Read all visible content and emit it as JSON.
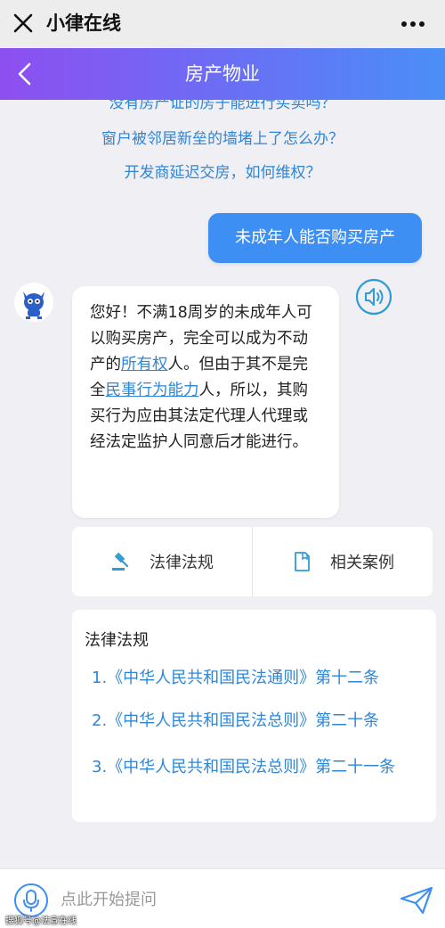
{
  "topbar": {
    "app_title": "小律在线"
  },
  "header": {
    "title": "房产物业"
  },
  "suggestions": [
    "没有房产证的房子能进行买卖吗？",
    "窗户被邻居新垒的墙堵上了怎么办？",
    "开发商延迟交房，如何维权？"
  ],
  "user_message": "未成年人能否购买房产",
  "bot_message": {
    "part1": "您好！不满18周岁的未成年人可以购买房产，完全可以成为不动产的",
    "link1": "所有权",
    "part2": "人。但由于其不是完全",
    "link2": "民事行为能力",
    "part3": "人，所以，其购买行为应由其法定代理人代理或经法定监护人同意后才能进行。"
  },
  "tabs": [
    {
      "label": "法律法规",
      "icon": "gavel-icon"
    },
    {
      "label": "相关案例",
      "icon": "document-icon"
    }
  ],
  "laws": {
    "title": "法律法规",
    "items": [
      "1.《中华人民共和国民法通则》第十二条",
      "2.《中华人民共和国民法总则》第二十条",
      "3.《中华人民共和国民法总则》第二十一条"
    ]
  },
  "input": {
    "placeholder": "点此开始提问"
  },
  "watermark": "搜狐号@法宣在线",
  "colors": {
    "accent": "#3d8ff3",
    "link": "#2f86d6",
    "header_start": "#8e4ff0",
    "header_end": "#4a8ff7"
  }
}
